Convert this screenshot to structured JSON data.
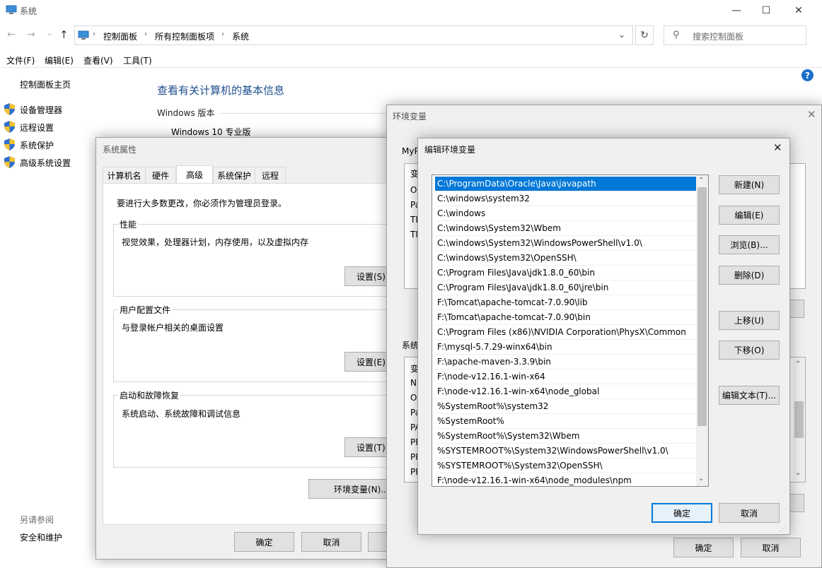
{
  "window": {
    "title": "系统",
    "breadcrumb": [
      "控制面板",
      "所有控制面板项",
      "系统"
    ],
    "search_placeholder": "搜索控制面板",
    "menu": [
      "文件(F)",
      "编辑(E)",
      "查看(V)",
      "工具(T)"
    ]
  },
  "sidebar": {
    "home": "控制面板主页",
    "items": [
      "设备管理器",
      "远程设置",
      "系统保护",
      "高级系统设置"
    ],
    "see_also": "另请参阅",
    "security": "安全和维护"
  },
  "main": {
    "heading": "查看有关计算机的基本信息",
    "windows_edition_label": "Windows 版本",
    "windows_edition": "Windows 10 专业版"
  },
  "sysprops": {
    "title": "系统属性",
    "tabs": [
      "计算机名",
      "硬件",
      "高级",
      "系统保护",
      "远程"
    ],
    "admin_note": "要进行大多数更改，你必须作为管理员登录。",
    "perf_label": "性能",
    "perf_desc": "视觉效果，处理器计划，内存使用，以及虚拟内存",
    "perf_btn": "设置(S)...",
    "profile_label": "用户配置文件",
    "profile_desc": "与登录帐户相关的桌面设置",
    "profile_btn": "设置(E)...",
    "startup_label": "启动和故障恢复",
    "startup_desc": "系统启动、系统故障和调试信息",
    "startup_btn": "设置(T)...",
    "env_btn": "环境变量(N)...",
    "ok": "确定",
    "cancel": "取消"
  },
  "envvars": {
    "title": "环境变量",
    "user_label": "MyP",
    "user_col": "变",
    "user_rows": [
      "On",
      "Pa",
      "TE",
      "TM"
    ],
    "sys_label": "系统",
    "sys_col": "变",
    "sys_rows": [
      "NU",
      "OS",
      "Pa",
      "PA",
      "PR",
      "PR",
      "PR"
    ],
    "ok": "确定",
    "cancel": "取消"
  },
  "editenv": {
    "title": "编辑环境变量",
    "paths": [
      "C:\\ProgramData\\Oracle\\Java\\javapath",
      "C:\\windows\\system32",
      "C:\\windows",
      "C:\\windows\\System32\\Wbem",
      "C:\\windows\\System32\\WindowsPowerShell\\v1.0\\",
      "C:\\windows\\System32\\OpenSSH\\",
      "C:\\Program Files\\Java\\jdk1.8.0_60\\bin",
      "C:\\Program Files\\Java\\jdk1.8.0_60\\jre\\bin",
      "F:\\Tomcat\\apache-tomcat-7.0.90\\lib",
      "F:\\Tomcat\\apache-tomcat-7.0.90\\bin",
      "C:\\Program Files (x86)\\NVIDIA Corporation\\PhysX\\Common",
      "F:\\mysql-5.7.29-winx64\\bin",
      "F:\\apache-maven-3.3.9\\bin",
      "F:\\node-v12.16.1-win-x64",
      "F:\\node-v12.16.1-win-x64\\node_global",
      "%SystemRoot%\\system32",
      "%SystemRoot%",
      "%SystemRoot%\\System32\\Wbem",
      "%SYSTEMROOT%\\System32\\WindowsPowerShell\\v1.0\\",
      "%SYSTEMROOT%\\System32\\OpenSSH\\",
      "F:\\node-v12.16.1-win-x64\\node_modules\\npm"
    ],
    "buttons": {
      "new": "新建(N)",
      "edit": "编辑(E)",
      "browse": "浏览(B)...",
      "delete": "删除(D)",
      "up": "上移(U)",
      "down": "下移(O)",
      "edit_text": "编辑文本(T)..."
    },
    "ok": "确定",
    "cancel": "取消"
  },
  "colors": {
    "accent": "#0078d7",
    "link": "#0066cc",
    "heading": "#1e4e8c"
  }
}
